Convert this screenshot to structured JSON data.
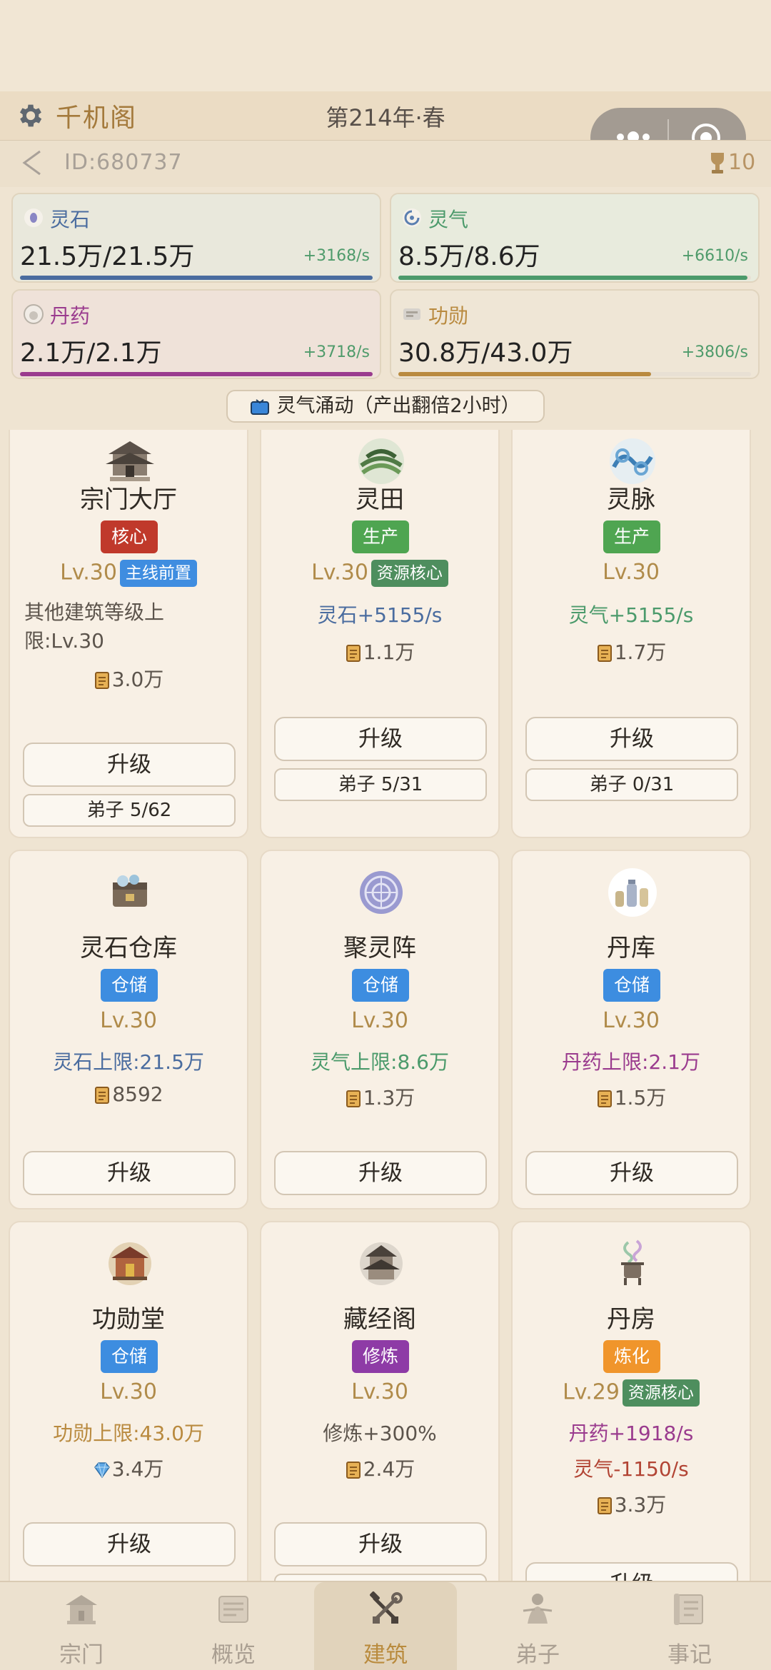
{
  "header": {
    "sect_name": "千机阁",
    "year": "第214年·春",
    "user_id": "ID:680737",
    "cup_count": "10"
  },
  "colors": {
    "spirit_stone": "#4a6c9f",
    "spirit_qi": "#4b9a6b",
    "pill": "#9a3b8e",
    "merit": "#b98a3f",
    "tag_core": "#c0392b",
    "tag_produce": "#4fa551",
    "tag_storage": "#3d8de0",
    "tag_cultivate": "#8e3ba6",
    "tag_refine": "#f0952b",
    "tag_main": "#3f8de0",
    "tag_resource": "#4e8e5e",
    "red_effect": "#b24434",
    "gold": "#b08b4a"
  },
  "resources": [
    {
      "label": "灵石",
      "value": "21.5万/21.5万",
      "rate": "+3168/s",
      "fill": 1.0,
      "icon": "spirit-stone-icon"
    },
    {
      "label": "灵气",
      "value": "8.5万/8.6万",
      "rate": "+6610/s",
      "fill": 0.99,
      "icon": "spirit-qi-icon"
    },
    {
      "label": "丹药",
      "value": "2.1万/2.1万",
      "rate": "+3718/s",
      "fill": 1.0,
      "icon": "pill-icon"
    },
    {
      "label": "功勋",
      "value": "30.8万/43.0万",
      "rate": "+3806/s",
      "fill": 0.716,
      "icon": "merit-icon"
    }
  ],
  "boost": {
    "label": "灵气涌动（产出翻倍2小时）"
  },
  "buildings": [
    {
      "name": "宗门大厅",
      "tag": "核心",
      "level": "Lv.30",
      "mini_tag": "主线前置",
      "desc": "其他建筑等级上限:Lv.30",
      "cost": "3.0万",
      "upgrade": "升级",
      "disciples": "弟子 5/62"
    },
    {
      "name": "灵田",
      "tag": "生产",
      "level": "Lv.30",
      "mini_tag": "资源核心",
      "effect": "灵石+5155/s",
      "cost": "1.1万",
      "upgrade": "升级",
      "disciples": "弟子 5/31"
    },
    {
      "name": "灵脉",
      "tag": "生产",
      "level": "Lv.30",
      "effect": "灵气+5155/s",
      "cost": "1.7万",
      "upgrade": "升级",
      "disciples": "弟子 0/31"
    },
    {
      "name": "灵石仓库",
      "tag": "仓储",
      "level": "Lv.30",
      "effect": "灵石上限:21.5万",
      "cost": "8592",
      "upgrade": "升级"
    },
    {
      "name": "聚灵阵",
      "tag": "仓储",
      "level": "Lv.30",
      "effect": "灵气上限:8.6万",
      "cost": "1.3万",
      "upgrade": "升级"
    },
    {
      "name": "丹库",
      "tag": "仓储",
      "level": "Lv.30",
      "effect": "丹药上限:2.1万",
      "cost": "1.5万",
      "upgrade": "升级"
    },
    {
      "name": "功勋堂",
      "tag": "仓储",
      "level": "Lv.30",
      "effect": "功勋上限:43.0万",
      "cost": "3.4万",
      "upgrade": "升级"
    },
    {
      "name": "藏经阁",
      "tag": "修炼",
      "level": "Lv.30",
      "effect": "修炼+300%",
      "cost": "2.4万",
      "upgrade": "升级"
    },
    {
      "name": "丹房",
      "tag": "炼化",
      "level": "Lv.29",
      "mini_tag": "资源核心",
      "effect": "丹药+1918/s",
      "effect2": "灵气-1150/s",
      "cost": "3.3万",
      "upgrade": "升级"
    }
  ],
  "nav": [
    {
      "label": "宗门",
      "icon": "sect-icon",
      "active": false
    },
    {
      "label": "概览",
      "icon": "overview-icon",
      "active": false
    },
    {
      "label": "建筑",
      "icon": "building-tools-icon",
      "active": true
    },
    {
      "label": "弟子",
      "icon": "disciple-icon",
      "active": false
    },
    {
      "label": "事记",
      "icon": "records-icon",
      "active": false
    }
  ]
}
